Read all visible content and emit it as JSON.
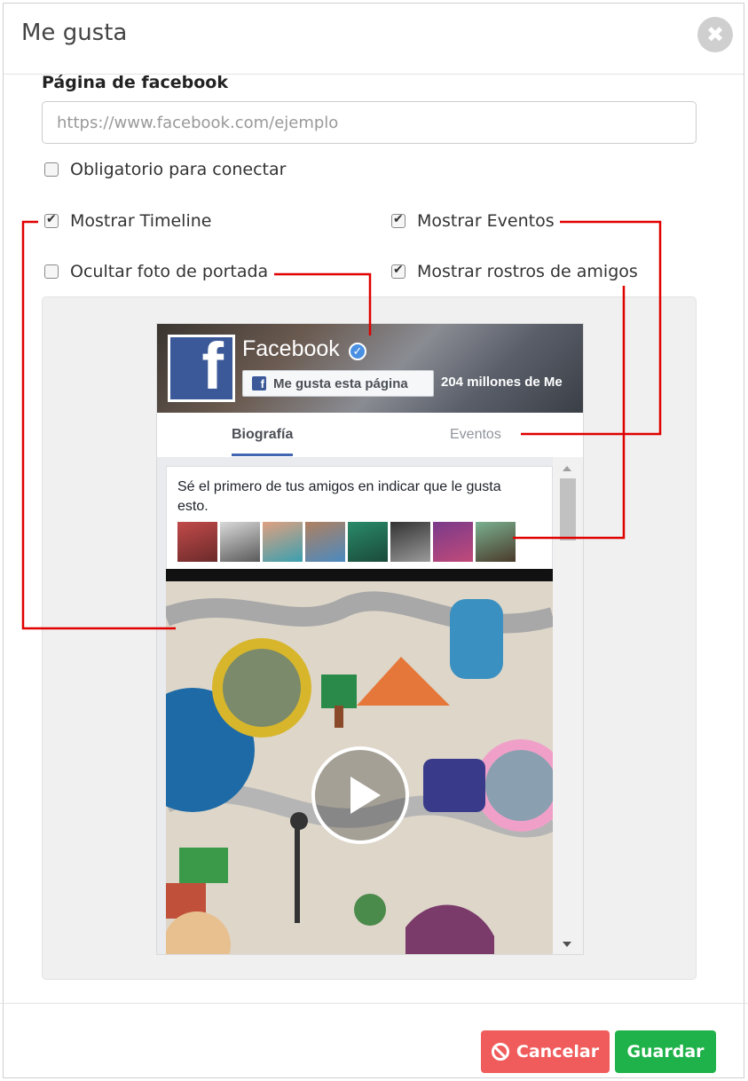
{
  "modal": {
    "title": "Me gusta",
    "close_label": "✖"
  },
  "form": {
    "page_label": "Página de facebook",
    "url_placeholder": "https://www.facebook.com/ejemplo",
    "url_value": "",
    "options": {
      "required": {
        "label": "Obligatorio para conectar",
        "checked": false
      },
      "show_timeline": {
        "label": "Mostrar Timeline",
        "checked": true
      },
      "show_events": {
        "label": "Mostrar Eventos",
        "checked": true
      },
      "hide_cover": {
        "label": "Ocultar foto de portada",
        "checked": false
      },
      "show_faces": {
        "label": "Mostrar rostros de amigos",
        "checked": true
      }
    }
  },
  "preview": {
    "page_name": "Facebook",
    "like_button": "Me gusta esta página",
    "likes_count": "204 millones de Me",
    "tabs": {
      "timeline": "Biografía",
      "events": "Eventos"
    },
    "friends_text": "Sé el primero de tus amigos en indicar que le gusta esto.",
    "colors": {
      "facebook_blue": "#3b5998",
      "tab_underline": "#4267b2",
      "annotation_line": "#e00000"
    }
  },
  "footer": {
    "cancel_label": "Cancelar",
    "save_label": "Guardar",
    "colors": {
      "cancel": "#f05c5c",
      "save": "#20b24a"
    }
  }
}
